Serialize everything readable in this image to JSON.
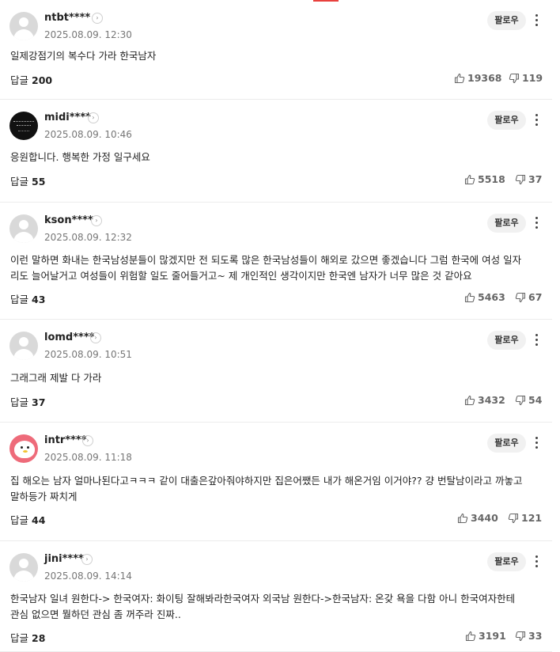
{
  "reply_label": "답글",
  "follow_label": "팔로우",
  "comments": [
    {
      "nick": "ntbt****",
      "date": "2025.08.09. 12:30",
      "text": "일제강점기의 복수다 가라 한국남자",
      "replies": "200",
      "likes": "19368",
      "dislikes": "119",
      "avatar": "default"
    },
    {
      "nick": "midi****",
      "date": "2025.08.09. 10:46",
      "text": "응원합니다. 행복한 가정 일구세요",
      "replies": "55",
      "likes": "5518",
      "dislikes": "37",
      "avatar": "dark"
    },
    {
      "nick": "kson****",
      "date": "2025.08.09. 12:32",
      "text": "이런 말하면 화내는 한국남성분들이 많겠지만 전 되도록 많은 한국남성들이 해외로 갔으면 좋겠습니다 그럼 한국에 여성 일자리도 늘어날거고 여성들이 위험할 일도 줄어들거고~ 제 개인적인 생각이지만 한국엔 남자가 너무 많은 것 같아요",
      "replies": "43",
      "likes": "5463",
      "dislikes": "67",
      "avatar": "default"
    },
    {
      "nick": "lomd****",
      "date": "2025.08.09. 10:51",
      "text": "그래그래 제발 다 가라",
      "replies": "37",
      "likes": "3432",
      "dislikes": "54",
      "avatar": "default"
    },
    {
      "nick": "intr****",
      "date": "2025.08.09. 11:18",
      "text": "집 해오는 남자 얼마나된다고ㅋㅋㅋ 같이 대출은갚아줘야하지만 집은어쨌든 내가 해온거임 이거야?? 걍 번탈남이라고 까놓고 말하등가 짜치게",
      "replies": "44",
      "likes": "3440",
      "dislikes": "121",
      "avatar": "pink"
    },
    {
      "nick": "jini****",
      "date": "2025.08.09. 14:14",
      "text": "한국남자 일녀 원한다-> 한국여자: 화이팅 잘해봐라한국여자 외국남 원한다->한국남자: 온갖 욕을 다함 아니 한국여자한테 관심 없으면 뭘하던 관심 좀 꺼주라 진짜..",
      "replies": "28",
      "likes": "3191",
      "dislikes": "33",
      "avatar": "default"
    }
  ]
}
